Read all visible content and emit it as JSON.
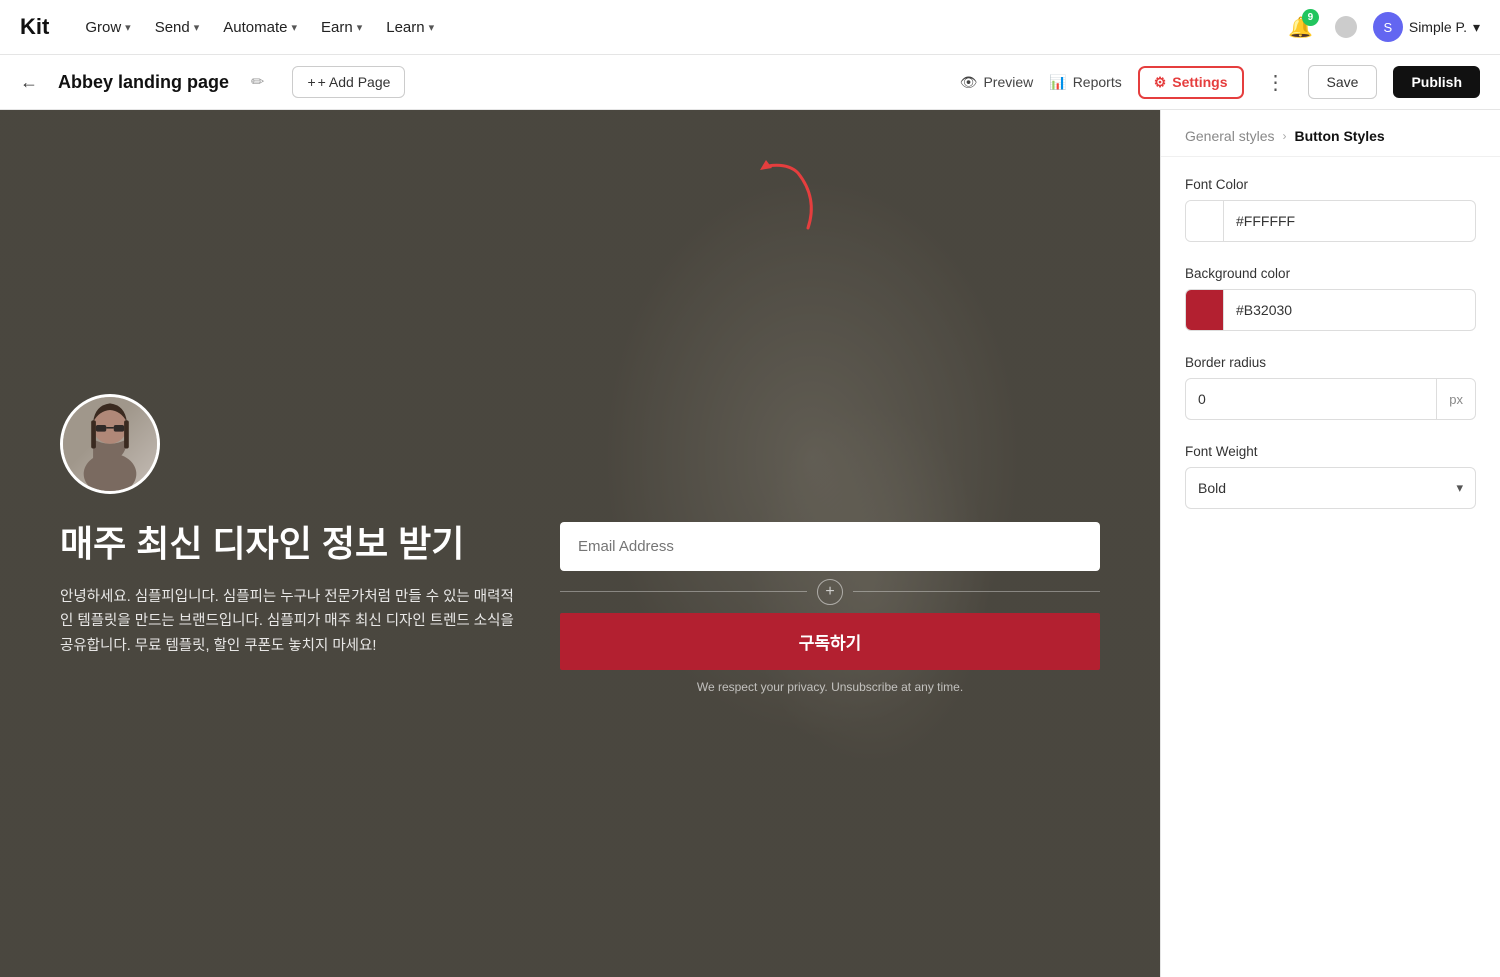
{
  "logo": "Kit",
  "nav": {
    "items": [
      {
        "label": "Grow",
        "id": "grow"
      },
      {
        "label": "Send",
        "id": "send"
      },
      {
        "label": "Automate",
        "id": "automate"
      },
      {
        "label": "Earn",
        "id": "earn"
      },
      {
        "label": "Learn",
        "id": "learn"
      }
    ]
  },
  "notifications": {
    "badge_count": "9"
  },
  "user": {
    "name": "Simple P.",
    "initial": "S"
  },
  "toolbar": {
    "back_label": "←",
    "page_title": "Abbey landing page",
    "edit_icon": "✏",
    "add_page_label": "+ Add Page",
    "preview_label": "Preview",
    "reports_label": "Reports",
    "settings_label": "Settings",
    "more_icon": "⋮",
    "save_label": "Save",
    "publish_label": "Publish"
  },
  "landing_page": {
    "heading": "매주 최신 디자인 정보 받기",
    "description": "안녕하세요. 심플피입니다. 심플피는 누구나 전문가처럼 만들 수 있는 매력적인 템플릿을 만드는 브랜드입니다. 심플피가 매주 최신 디자인 트렌드 소식을 공유합니다. 무료 템플릿, 할인 쿠폰도 놓치지 마세요!",
    "email_placeholder": "Email Address",
    "submit_label": "구독하기",
    "privacy_text": "We respect your privacy. Unsubscribe at any time."
  },
  "settings_panel": {
    "breadcrumb_parent": "General styles",
    "breadcrumb_current": "Button Styles",
    "fields": [
      {
        "id": "font_color",
        "label": "Font Color",
        "type": "color",
        "swatch_class": "white",
        "value": "#FFFFFF"
      },
      {
        "id": "background_color",
        "label": "Background color",
        "type": "color",
        "swatch_class": "red",
        "value": "#B32030"
      },
      {
        "id": "border_radius",
        "label": "Border radius",
        "type": "text_with_unit",
        "value": "0",
        "unit": "px"
      },
      {
        "id": "font_weight",
        "label": "Font Weight",
        "type": "select",
        "value": "Bold"
      }
    ]
  }
}
